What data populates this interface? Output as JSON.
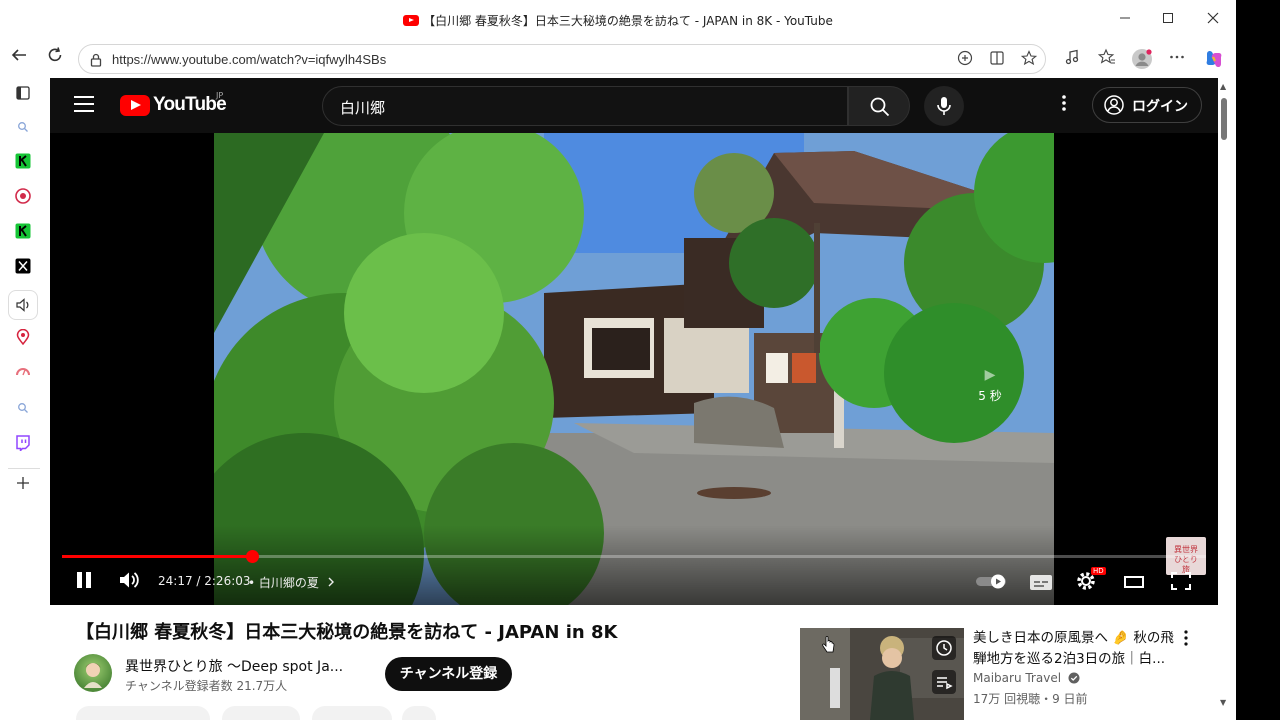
{
  "browser": {
    "window_title": "【白川郷 春夏秋冬】日本三大秘境の絶景を訪ねて - JAPAN in 8K - YouTube",
    "url": "https://www.youtube.com/watch?v=iqfwylh4SBs",
    "icons": [
      "back-icon",
      "refresh-icon",
      "lock-icon",
      "translate-icon",
      "split-screen-icon",
      "favorite-icon",
      "music-icon",
      "favorites-icon",
      "profile-icon",
      "more-icon",
      "copilot-icon"
    ],
    "window_controls": [
      "minimize-icon",
      "maximize-icon",
      "close-icon"
    ]
  },
  "sidebar": {
    "items": [
      "sidebar-toggle-icon",
      "search-icon",
      "kindle-icon",
      "app-icon",
      "kindle-icon",
      "x-icon",
      "audio-icon",
      "location-icon",
      "gauge-icon",
      "search-icon",
      "twitch-icon",
      "add-icon"
    ]
  },
  "youtube": {
    "logo_text": "YouTube",
    "region": "JP",
    "search_query": "白川郷",
    "login_label": "ログイン"
  },
  "player": {
    "skip_label": "5 秒",
    "time_text": "24:17 / 2:26:03",
    "chapter_text": "• 白川郷の夏",
    "progress_fraction": 0.166,
    "watermark_text": "異世界ひとり旅",
    "hd_badge": "HD",
    "accent_color": "#ff0000"
  },
  "video": {
    "title": "【白川郷 春夏秋冬】日本三大秘境の絶景を訪ねて - JAPAN in 8K",
    "channel_name": "異世界ひとり旅 〜Deep spot Ja...",
    "subscribers": "チャンネル登録者数 21.7万人",
    "subscribe_label": "チャンネル登録"
  },
  "recommendation": {
    "title_line1": "美しき日本の原風景へ 🤌 秋の飛",
    "title_line2": "騨地方を巡る2泊3日の旅｜白...",
    "channel": "Maibaru Travel",
    "meta": "17万 回視聴・9 日前"
  }
}
